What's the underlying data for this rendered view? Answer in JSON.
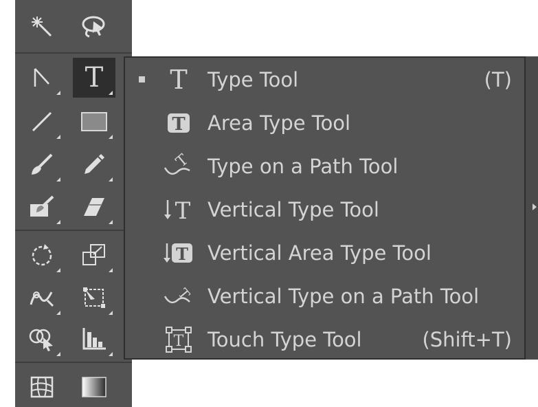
{
  "toolbar": {
    "tools": [
      {
        "name": "magic-wand-tool-icon"
      },
      {
        "name": "lasso-tool-icon"
      },
      {
        "name": "direct-selection-tool-icon"
      },
      {
        "name": "type-tool-icon",
        "active": true
      },
      {
        "name": "line-segment-tool-icon"
      },
      {
        "name": "rectangle-tool-icon"
      },
      {
        "name": "paintbrush-tool-icon"
      },
      {
        "name": "pencil-tool-icon"
      },
      {
        "name": "blob-brush-tool-icon"
      },
      {
        "name": "eraser-tool-icon"
      },
      {
        "name": "rotate-tool-icon"
      },
      {
        "name": "scale-tool-icon"
      },
      {
        "name": "warp-tool-icon"
      },
      {
        "name": "free-transform-tool-icon"
      },
      {
        "name": "shape-builder-tool-icon"
      },
      {
        "name": "graph-tool-icon"
      },
      {
        "name": "mesh-tool-icon"
      },
      {
        "name": "gradient-tool-icon"
      }
    ]
  },
  "flyout": {
    "items": [
      {
        "label": "Type Tool",
        "shortcut": "(T)",
        "selected": true,
        "icon": "type-icon"
      },
      {
        "label": "Area Type Tool",
        "shortcut": "",
        "icon": "area-type-icon"
      },
      {
        "label": "Type on a Path Tool",
        "shortcut": "",
        "icon": "type-on-path-icon"
      },
      {
        "label": "Vertical Type Tool",
        "shortcut": "",
        "icon": "vertical-type-icon"
      },
      {
        "label": "Vertical Area Type Tool",
        "shortcut": "",
        "icon": "vertical-area-type-icon"
      },
      {
        "label": "Vertical Type on a Path Tool",
        "shortcut": "",
        "icon": "vertical-type-on-path-icon"
      },
      {
        "label": "Touch Type Tool",
        "shortcut": "(Shift+T)",
        "icon": "touch-type-icon"
      }
    ]
  },
  "colors": {
    "panel": "#535353",
    "active": "#2e2e2e",
    "text": "#d4d4d4"
  }
}
